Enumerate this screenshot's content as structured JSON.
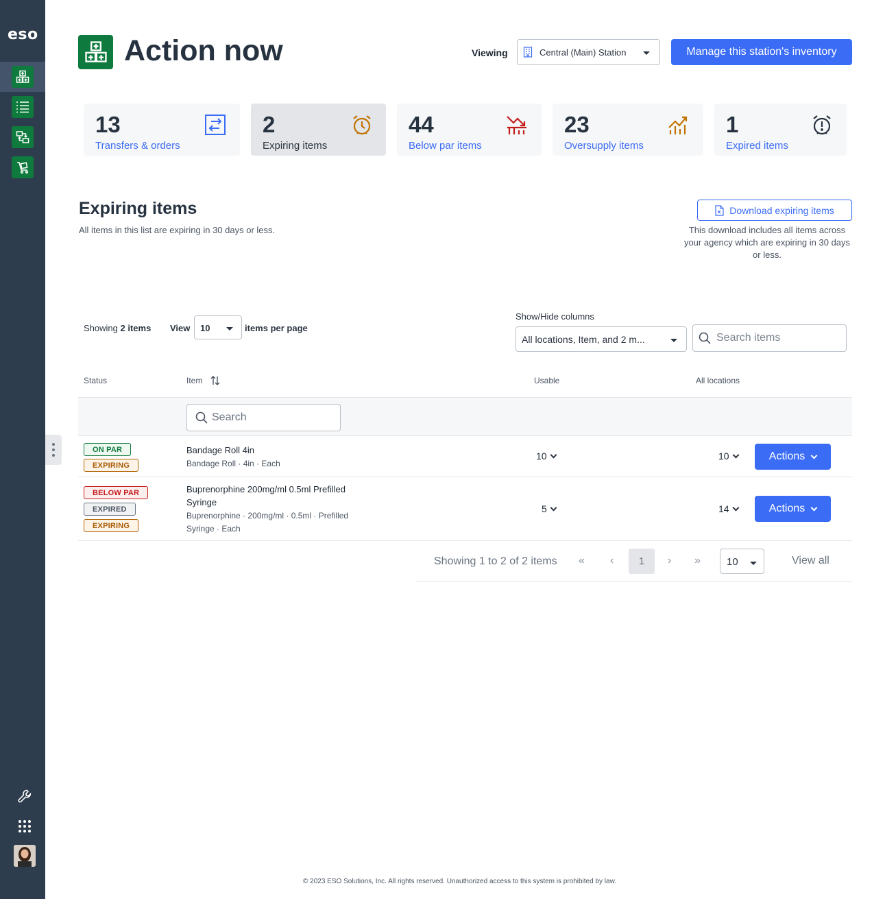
{
  "sidebar": {
    "logo": "eso",
    "nav": [
      {
        "name": "action-now",
        "icon": "medical-boxes-icon",
        "active": true
      },
      {
        "name": "list",
        "icon": "list-icon",
        "active": false
      },
      {
        "name": "transfers",
        "icon": "transfer-icon",
        "active": false
      },
      {
        "name": "orders",
        "icon": "cart-icon",
        "active": false
      }
    ],
    "bottom": [
      "wrench-icon",
      "apps-grid-icon",
      "user-avatar"
    ]
  },
  "header": {
    "title": "Action now",
    "viewing_label": "Viewing",
    "station": "Central (Main) Station",
    "manage_button": "Manage this station's inventory"
  },
  "stats": [
    {
      "value": "13",
      "label": "Transfers & orders",
      "icon": "transfer-arrows-icon",
      "color": "#3b6cf5"
    },
    {
      "value": "2",
      "label": "Expiring items",
      "icon": "alarm-clock-icon",
      "color": "#c27200"
    },
    {
      "value": "44",
      "label": "Below par items",
      "icon": "trend-down-icon",
      "color": "#c41a1a"
    },
    {
      "value": "23",
      "label": "Oversupply items",
      "icon": "trend-up-icon",
      "color": "#c27200"
    },
    {
      "value": "1",
      "label": "Expired items",
      "icon": "alarm-alert-icon",
      "color": "#263240"
    }
  ],
  "section": {
    "title": "Expiring items",
    "subtitle": "All items in this list are expiring in 30 days or less.",
    "download_button": "Download expiring items",
    "download_note": "This download includes all items across your agency which are expiring in 30 days or less."
  },
  "controls": {
    "showing_prefix": "Showing",
    "showing_count": "2 items",
    "view_label": "View",
    "per_page": "10",
    "per_page_label": "items per page",
    "columns_label": "Show/Hide columns",
    "columns_value": "All locations, Item, and 2 m...",
    "search_placeholder": "Search items"
  },
  "table": {
    "headers": {
      "status": "Status",
      "item": "Item",
      "usable": "Usable",
      "all_locations": "All locations"
    },
    "filter_placeholder": "Search",
    "rows": [
      {
        "badges": [
          "ON PAR",
          "EXPIRING"
        ],
        "name": "Bandage Roll 4in",
        "desc": "Bandage Roll · 4in · Each",
        "usable": "10",
        "all_locations": "10",
        "action": "Actions"
      },
      {
        "badges": [
          "BELOW PAR",
          "EXPIRED",
          "EXPIRING"
        ],
        "name": "Buprenorphine 200mg/ml 0.5ml Prefilled Syringe",
        "desc": "Buprenorphine · 200mg/ml · 0.5ml · Prefilled Syringe · Each",
        "usable": "5",
        "all_locations": "14",
        "action": "Actions"
      }
    ]
  },
  "pagination": {
    "summary": "Showing 1 to 2 of 2 items",
    "current_page": "1",
    "page_size": "10",
    "view_all": "View all"
  },
  "footer": "© 2023 ESO Solutions, Inc. All rights reserved. Unauthorized access to this system is prohibited by law."
}
